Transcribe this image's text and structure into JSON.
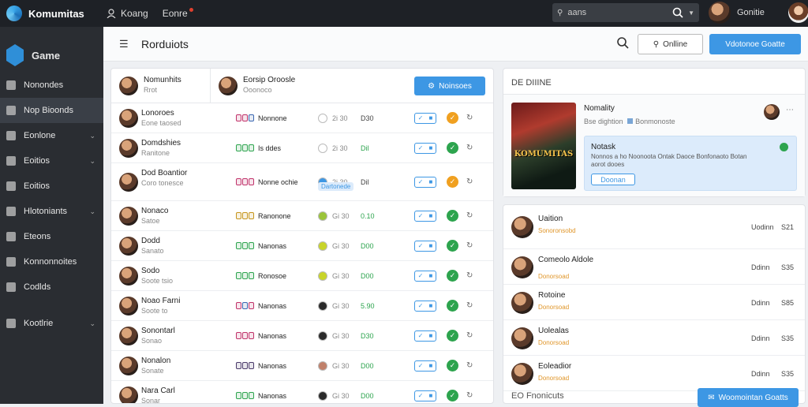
{
  "topbar": {
    "app_name": "Komumitas",
    "nav": [
      {
        "label": "Koang",
        "icon": "user-icon"
      },
      {
        "label": "Eonre",
        "icon": "notification-icon"
      }
    ],
    "search_text": "aans",
    "user_name": "Gonitie"
  },
  "sidebar": {
    "title": "Game",
    "items": [
      {
        "label": "Nonondes",
        "icon": "home-icon",
        "chevron": false
      },
      {
        "label": "Nop Bioonds",
        "icon": "bookmark-icon",
        "chevron": false,
        "active": true
      },
      {
        "label": "Eonlone",
        "icon": "globe-icon",
        "chevron": true
      },
      {
        "label": "Eoitios",
        "icon": "folder-icon",
        "chevron": true
      },
      {
        "label": "Eoitios",
        "icon": "list-icon",
        "chevron": false
      },
      {
        "label": "Hlotoniants",
        "icon": "chat-icon",
        "chevron": true
      },
      {
        "label": "Eteons",
        "icon": "grid-icon",
        "chevron": false
      },
      {
        "label": "Konnonnoites",
        "icon": "link-icon",
        "chevron": false
      },
      {
        "label": "Codlds",
        "icon": "cards-icon",
        "chevron": false
      },
      {
        "label": "Kootlrie",
        "icon": "settings-icon",
        "chevron": true
      }
    ]
  },
  "header": {
    "title": "Rorduiots",
    "online_button": "Onlline",
    "primary_button": "Vdotonoe Goatte"
  },
  "list_panel": {
    "head_user1": {
      "name": "Nomunhits",
      "sub": "Rrot"
    },
    "head_user2": {
      "name": "Eorsip Oroosle",
      "sub": "Ooonoco"
    },
    "head_button": "Noinsoes",
    "rows": [
      {
        "name": "Lonoroes",
        "sub": "Eone taosed",
        "tag": "Nonnone",
        "chips": [
          "#c0326a",
          "#c0326a",
          "#3a66b0"
        ],
        "dot": "#ffffff",
        "stat": "2i 30",
        "val": "D30",
        "valColor": "#444",
        "status": "#f0a020",
        "mark": "✓"
      },
      {
        "name": "Domdshies",
        "sub": "Ranitone",
        "tag": "Is ddes",
        "chips": [
          "#2da44e",
          "#2da44e",
          "#2da44e"
        ],
        "dot": "#ffffff",
        "stat": "2i 30",
        "val": "Dil",
        "valColor": "#2da44e",
        "status": "#2da44e",
        "mark": "✓"
      },
      {
        "name": "Dod Boantior",
        "sub": "Coro tonesce",
        "tag": "Nonne ochie",
        "chips": [
          "#c0326a",
          "#c0326a",
          "#c0326a"
        ],
        "dot": "#3d97e4",
        "stat": "2i 30",
        "val": "Dil",
        "valColor": "#444",
        "status": "#f0a020",
        "mark": "✓",
        "badge": "Dartonede"
      },
      {
        "name": "Nonaco",
        "sub": "Satoe",
        "tag": "Ranonone",
        "chips": [
          "#c6951c",
          "#c6951c",
          "#c6951c"
        ],
        "dot": "#9bc43a",
        "stat": "Gi 30",
        "val": "0.10",
        "valColor": "#2da44e",
        "status": "#2da44e",
        "mark": "✓"
      },
      {
        "name": "Dodd",
        "sub": "Sanato",
        "tag": "Nanonas",
        "chips": [
          "#2da44e",
          "#2da44e",
          "#2da44e"
        ],
        "dot": "#c8d42a",
        "stat": "Gi 30",
        "val": "D00",
        "valColor": "#2da44e",
        "status": "#2da44e",
        "mark": "✓"
      },
      {
        "name": "Sodo",
        "sub": "Soote tsio",
        "tag": "Ronosoe",
        "chips": [
          "#2da44e",
          "#2da44e",
          "#2da44e"
        ],
        "dot": "#c8d42a",
        "stat": "Gi 30",
        "val": "D00",
        "valColor": "#2da44e",
        "status": "#2da44e",
        "mark": "✓"
      },
      {
        "name": "Noao Farni",
        "sub": "Soote to",
        "tag": "Nanonas",
        "chips": [
          "#c0326a",
          "#3a66b0",
          "#c0326a"
        ],
        "dot": "#2a2a2a",
        "stat": "Gi 30",
        "val": "5.90",
        "valColor": "#2da44e",
        "status": "#2da44e",
        "mark": "✓"
      },
      {
        "name": "Sonontarl",
        "sub": "Sonao",
        "tag": "Nanonas",
        "chips": [
          "#c0326a",
          "#c0326a",
          "#c0326a"
        ],
        "dot": "#2a2a2a",
        "stat": "Gi 30",
        "val": "D30",
        "valColor": "#2da44e",
        "status": "#2da44e",
        "mark": "✓"
      },
      {
        "name": "Nonalon",
        "sub": "Sonate",
        "tag": "Nanonas",
        "chips": [
          "#4a3a6a",
          "#4a3a6a",
          "#4a3a6a"
        ],
        "dot": "#c0806a",
        "stat": "Gi 30",
        "val": "D00",
        "valColor": "#2da44e",
        "status": "#2da44e",
        "mark": "✓"
      },
      {
        "name": "Nara Carl",
        "sub": "Sonar",
        "tag": "Nanonas",
        "chips": [
          "#2da44e",
          "#2da44e",
          "#2da44e"
        ],
        "dot": "#2a2a2a",
        "stat": "Gi 30",
        "val": "D00",
        "valColor": "#2da44e",
        "status": "#2da44e",
        "mark": "✓"
      }
    ]
  },
  "detail_panel": {
    "title": "DE DIIINE",
    "cover_text": "KOMUMITAS",
    "name": "Nomality",
    "meta": "Bse dightion",
    "meta2": "Bonmonoste",
    "note": {
      "title": "Notask",
      "desc": "Nonnos a ho Noonoota Ontak Daoce Bonfonaoto Botan aorot dooes",
      "button": "Doonan"
    }
  },
  "friends_panel": {
    "rows": [
      {
        "name": "Uaition",
        "sub": "Sonoronsobd",
        "status": "Uodinn",
        "val": "S21"
      },
      {
        "name": "Comeolo Aldole",
        "sub": "Donorsoad",
        "status": "Ddinn",
        "val": "S35"
      },
      {
        "name": "Rotoine",
        "sub": "Donorsoad",
        "status": "Ddinn",
        "val": "S85"
      },
      {
        "name": "Uolealas",
        "sub": "Donorsoad",
        "status": "Ddinn",
        "val": "S35"
      },
      {
        "name": "Eoleadior",
        "sub": "Donorsoad",
        "status": "Ddinn",
        "val": "S35"
      }
    ],
    "footer": "EO Fnonicuts",
    "footer_button": "Woomointan Goatts"
  }
}
